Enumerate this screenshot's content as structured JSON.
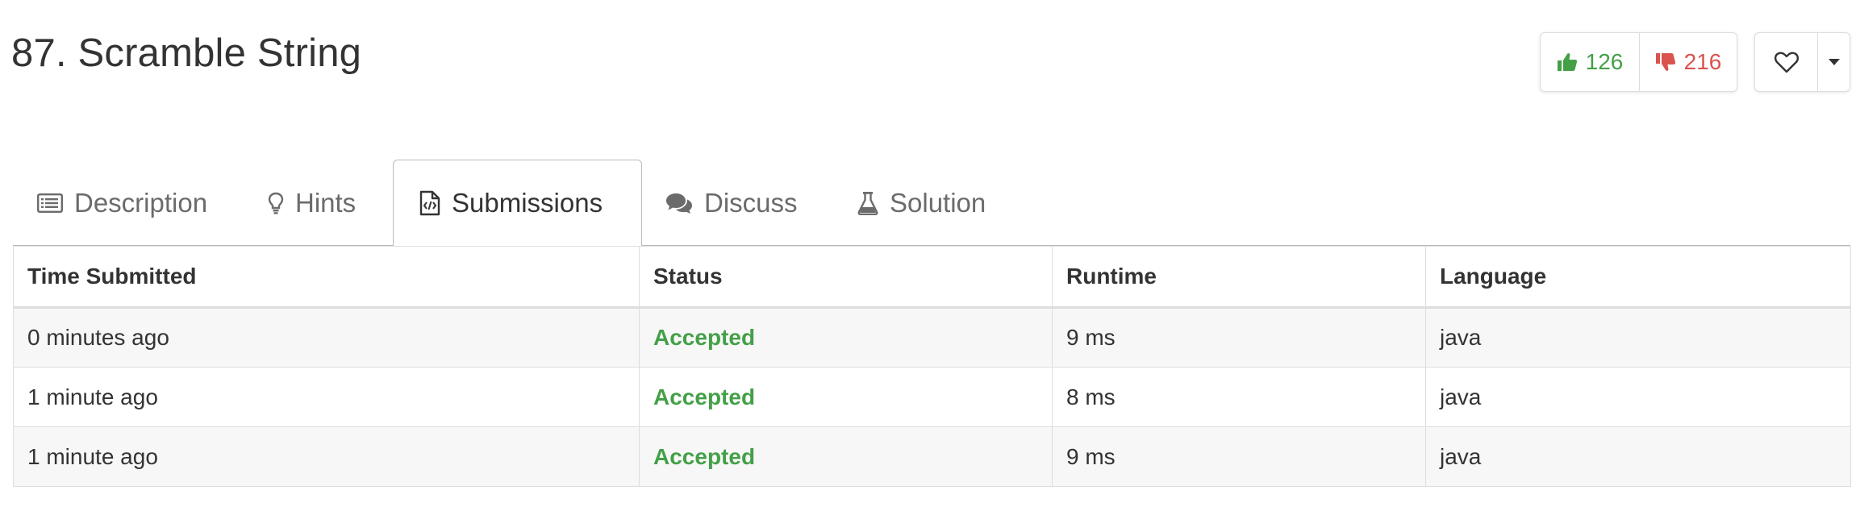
{
  "problem": {
    "title": "87. Scramble String"
  },
  "votes": {
    "likes": "126",
    "dislikes": "216",
    "like_color": "#43a047",
    "dislike_color": "#d9534f"
  },
  "favorite": {
    "icon": "heart-outline-icon",
    "menu_icon": "caret-down-icon"
  },
  "tabs": [
    {
      "label": "Description",
      "icon": "list-icon",
      "active": false
    },
    {
      "label": "Hints",
      "icon": "lightbulb-icon",
      "active": false
    },
    {
      "label": "Submissions",
      "icon": "code-file-icon",
      "active": true
    },
    {
      "label": "Discuss",
      "icon": "comments-icon",
      "active": false
    },
    {
      "label": "Solution",
      "icon": "flask-icon",
      "active": false
    }
  ],
  "table": {
    "headers": [
      "Time Submitted",
      "Status",
      "Runtime",
      "Language"
    ],
    "rows": [
      {
        "time": "0 minutes ago",
        "status": "Accepted",
        "runtime": "9 ms",
        "language": "java"
      },
      {
        "time": "1 minute ago",
        "status": "Accepted",
        "runtime": "8 ms",
        "language": "java"
      },
      {
        "time": "1 minute ago",
        "status": "Accepted",
        "runtime": "9 ms",
        "language": "java"
      }
    ],
    "accepted_color": "#43a047"
  }
}
